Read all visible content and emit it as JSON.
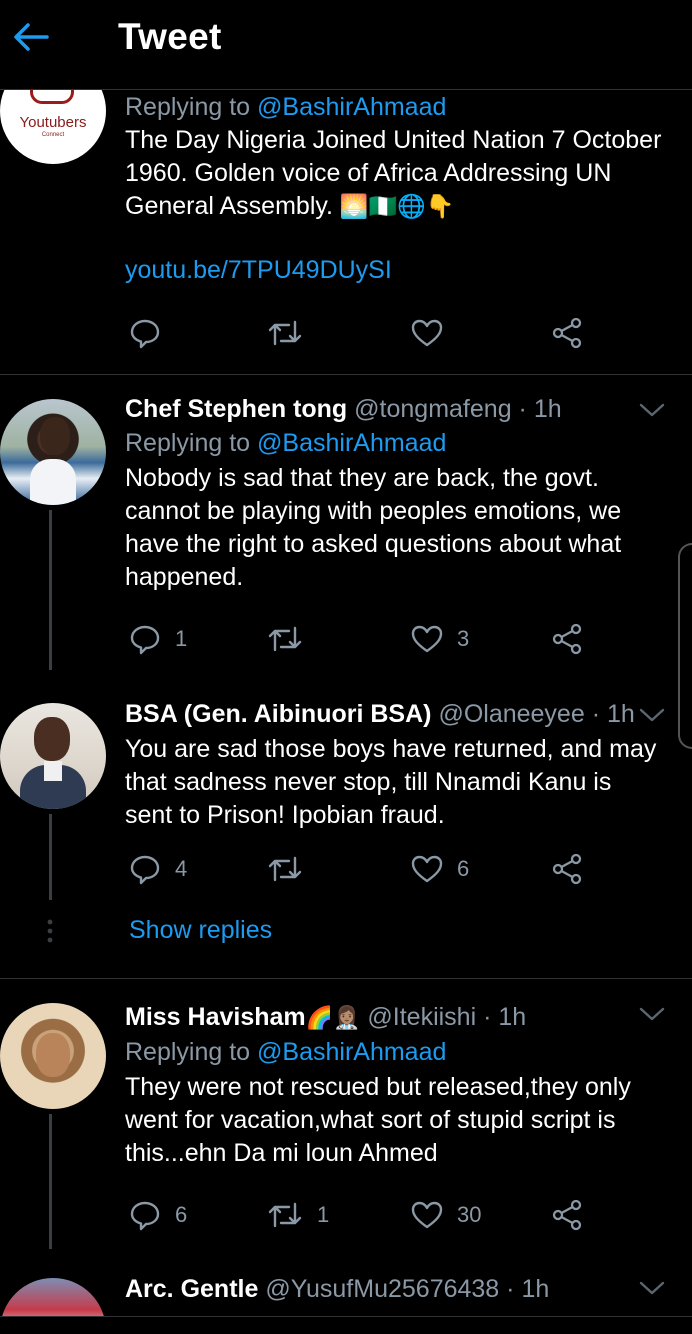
{
  "header": {
    "title": "Tweet"
  },
  "tweets": [
    {
      "avatar_label": "Youtubers",
      "avatar_sublabel": "Connect",
      "replying_prefix": "Replying to",
      "replying_handle": "@BashirAhmaad",
      "text": "The Day Nigeria Joined United Nation 7 October 1960. Golden voice of Africa Addressing UN General Assembly.",
      "emoji": "🌅🇳🇬🌐👇",
      "link": "youtu.be/7TPU49DUySI",
      "reply_count": "",
      "retweet_count": "",
      "like_count": ""
    },
    {
      "name": "Chef Stephen tong",
      "handle": "@tongmafeng",
      "time": "· 1h",
      "replying_prefix": "Replying to",
      "replying_handle": "@BashirAhmaad",
      "text": "Nobody is sad that they are back, the govt. cannot be playing with peoples emotions, we have the right to asked questions about what happened.",
      "reply_count": "1",
      "retweet_count": "",
      "like_count": "3"
    },
    {
      "name": "BSA (Gen. Aibinuori BSA)",
      "handle": "@Olaneeyee",
      "time": "· 1h",
      "text": "You are sad those boys have returned, and may that sadness never stop, till Nnamdi Kanu is sent to Prison! Ipobian fraud.",
      "reply_count": "4",
      "retweet_count": "",
      "like_count": "6"
    },
    {
      "name": "Miss Havisham",
      "name_emoji": "🌈👩🏽‍⚕️",
      "handle": "@Itekiishi",
      "time": "· 1h",
      "replying_prefix": "Replying to",
      "replying_handle": "@BashirAhmaad",
      "text": "They were not rescued but released,they only went for vacation,what sort of stupid script is this...ehn Da mi loun Ahmed",
      "reply_count": "6",
      "retweet_count": "1",
      "like_count": "30"
    },
    {
      "name": "Arc. Gentle",
      "handle": "@YusufMu25676438",
      "time": "· 1h"
    }
  ],
  "show_replies": "Show replies",
  "colors": {
    "accent": "#1d9bf0",
    "muted": "#8b98a5",
    "background": "#000000",
    "divider": "#2f3336"
  },
  "icons": [
    "back-arrow-icon",
    "reply-icon",
    "retweet-icon",
    "like-icon",
    "share-icon",
    "chevron-down-icon",
    "more-dots-icon"
  ]
}
